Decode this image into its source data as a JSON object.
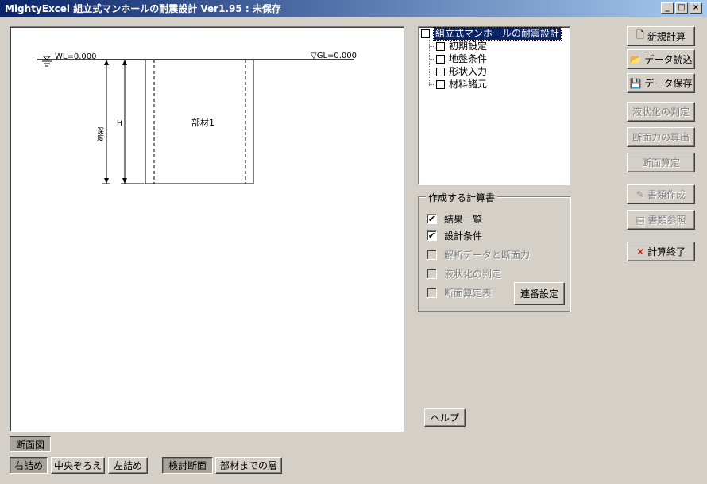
{
  "window": {
    "title": "MightyExcel 組立式マンホールの耐震設計  Ver1.95 : 未保存",
    "controls": [
      "_",
      "□",
      "×"
    ]
  },
  "drawing": {
    "wl_label": "WL=0.000",
    "gl_label": "▽GL=0.000",
    "depth_label": "深度",
    "height_label": "H",
    "member_label": "部材1"
  },
  "tree": {
    "root": "組立式マンホールの耐震設計",
    "items": [
      "初期設定",
      "地盤条件",
      "形状入力",
      "材料諸元"
    ]
  },
  "report_group": {
    "title": "作成する計算書",
    "options": [
      {
        "label": "結果一覧",
        "checked": true,
        "enabled": true
      },
      {
        "label": "設計条件",
        "checked": true,
        "enabled": true
      },
      {
        "label": "解析データと断面力",
        "checked": false,
        "enabled": false
      },
      {
        "label": "液状化の判定",
        "checked": false,
        "enabled": false
      },
      {
        "label": "断面算定表",
        "checked": false,
        "enabled": false
      }
    ],
    "numbering_button": "連番設定"
  },
  "side_buttons": {
    "new_calc": "新規計算",
    "data_load": "データ読込",
    "data_save": "データ保存",
    "liquefaction": "液状化の判定",
    "section_force": "断面力の算出",
    "section_check": "断面算定",
    "doc_create": "書類作成",
    "doc_view": "書類参照",
    "calc_end": "計算終了"
  },
  "help_button": "ヘルプ",
  "bottom": {
    "section_view": "断面図",
    "right_align": "右詰め",
    "center_align": "中央ぞろえ",
    "left_align": "左詰め",
    "check_section": "検討断面",
    "to_member_layer": "部材までの層"
  },
  "icons": {
    "new": "new-document-icon",
    "open": "open-folder-icon",
    "save": "floppy-disk-icon",
    "doc_create": "document-edit-icon",
    "doc_view": "documents-icon",
    "end": "red-x-icon"
  }
}
